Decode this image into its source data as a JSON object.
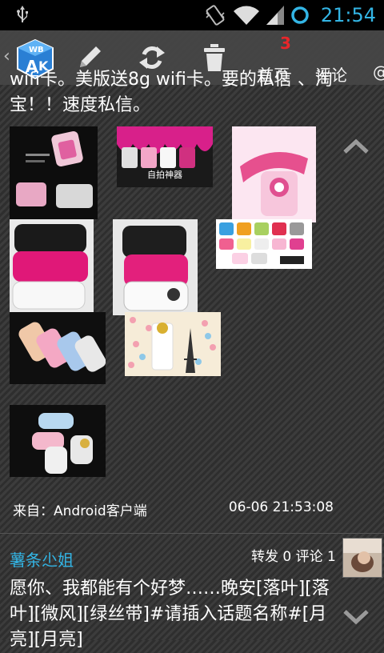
{
  "statusbar": {
    "time": "21:54",
    "icons": [
      "usb-icon",
      "vibrate-icon",
      "wifi-icon",
      "signal-icon",
      "sync-icon"
    ]
  },
  "toolbar": {
    "back_icon": "chevron-left-icon",
    "logo_icon": "app-logo-icon",
    "actions": [
      "compose-icon",
      "refresh-icon",
      "trash-icon"
    ],
    "tabs": [
      {
        "label": "首页",
        "badge": "3"
      },
      {
        "label": "评论"
      },
      {
        "label": "@"
      }
    ]
  },
  "post1": {
    "text": "wifi卡。美版送8g wifi卡。要的私信 、淘宝！！速度私信。",
    "source": "来自：Android客户端",
    "time": "06-06 21:53:08"
  },
  "post2": {
    "author": "薯条尐姐",
    "stats": "转发 0 评论 1",
    "text": "愿你、我都能有个好梦……晚安[落叶][落叶][微风][绿丝带]#请插入话题名称#[月亮][月亮]"
  },
  "colors": {
    "accent_blue": "#33b5e5",
    "badge_red": "#e8262a",
    "toolbar_bg": "#464646"
  }
}
